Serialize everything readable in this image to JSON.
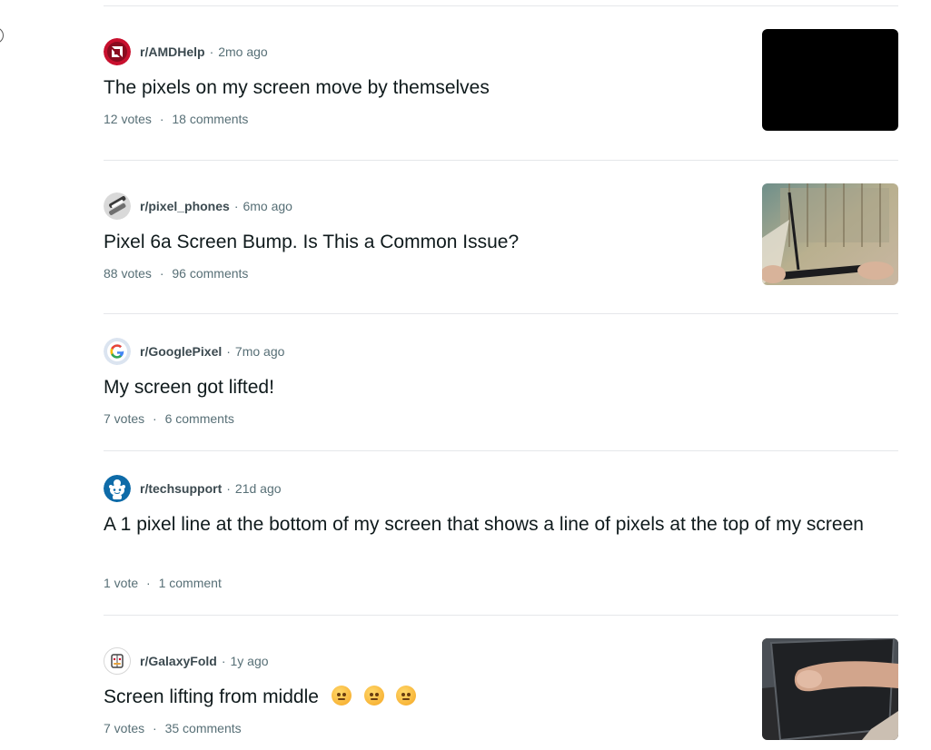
{
  "posts": [
    {
      "subreddit": "r/AMDHelp",
      "age": "2mo ago",
      "title": "The pixels on my screen move by themselves",
      "votes": "12 votes",
      "comments": "18 comments",
      "avatar_icon": "amd-logo-icon",
      "thumbnail": "black-screen-thumbnail"
    },
    {
      "subreddit": "r/pixel_phones",
      "age": "6mo ago",
      "title": "Pixel 6a Screen Bump. Is This a Common Issue?",
      "votes": "88 votes",
      "comments": "96 comments",
      "avatar_icon": "pixel-phones-icon",
      "thumbnail": "phone-edge-photo-thumbnail"
    },
    {
      "subreddit": "r/GooglePixel",
      "age": "7mo ago",
      "title": "My screen got lifted!",
      "votes": "7 votes",
      "comments": "6 comments",
      "avatar_icon": "google-g-icon"
    },
    {
      "subreddit": "r/techsupport",
      "age": "21d ago",
      "title": "A 1 pixel line at the bottom of my screen that shows a line of pixels at the top of my screen",
      "votes": "1 vote",
      "comments": "1 comment",
      "avatar_icon": "snoo-icon"
    },
    {
      "subreddit": "r/GalaxyFold",
      "age": "1y ago",
      "title": "Screen lifting from middle",
      "votes": "7 votes",
      "comments": "35 comments",
      "avatar_icon": "galaxy-fold-icon",
      "thumbnail": "finger-on-phone-thumbnail",
      "title_emojis": [
        "woozy-face-emoji",
        "woozy-face-emoji",
        "expressionless-face-emoji"
      ]
    }
  ],
  "separator": "·"
}
